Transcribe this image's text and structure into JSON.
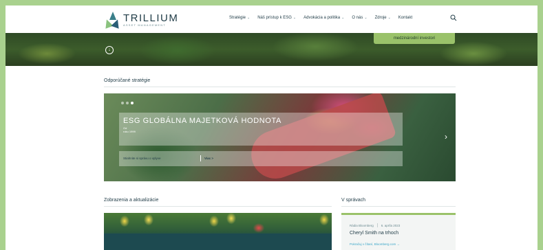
{
  "header": {
    "logo_name": "TRILLIUM",
    "logo_sub": "ASSET MANAGEMENT",
    "nav": [
      {
        "label": "Stratégie",
        "has_dropdown": true
      },
      {
        "label": "Náš prístup k ESG",
        "has_dropdown": true
      },
      {
        "label": "Advokácia a politika",
        "has_dropdown": true
      },
      {
        "label": "O nás",
        "has_dropdown": true
      },
      {
        "label": "Zdroje",
        "has_dropdown": true
      },
      {
        "label": "Kontakt",
        "has_dropdown": false
      }
    ],
    "search_icon": "search-icon"
  },
  "hero": {
    "button_label": "medzinárodní investori",
    "scroll_icon": "arrow-down-circle-icon"
  },
  "featured": {
    "section_title": "Odporúčané stratégie",
    "slide_title": "ESG GLOBÁLNA MAJETKOVÁ HODNOTA",
    "slide_sub1": "Od",
    "slide_sub2": "roku 1999",
    "link_report": "Stiahnite si správu o vplyve",
    "link_view": "Viac >",
    "next_icon": "chevron-right-icon",
    "dots": 3,
    "active_dot": 2
  },
  "views": {
    "section_title": "Zobrazenia a aktualizácie"
  },
  "news": {
    "section_title": "V správach",
    "source": "Rádia Bloomberg",
    "date": "6. apríla 2023",
    "title": "Cheryl Smith na trhoch",
    "link": "Pokračuj v čítaní, Bloomberg.com →"
  },
  "colors": {
    "accent_green": "#9ac26a",
    "navy": "#1f3b46",
    "link_blue": "#3aa6c8",
    "outer_bg": "#a9d18e"
  }
}
